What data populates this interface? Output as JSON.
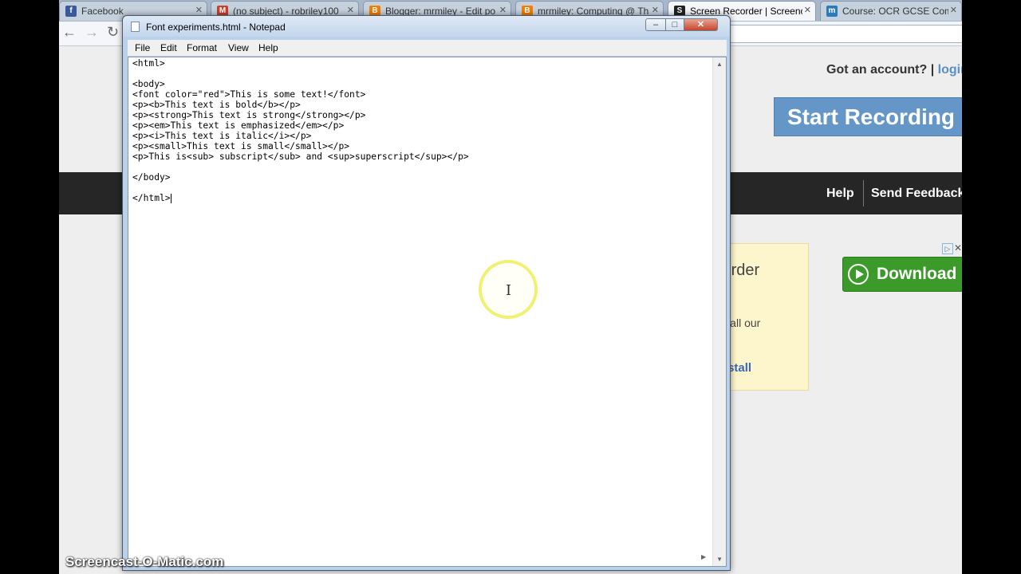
{
  "browser": {
    "tabs": [
      {
        "label": "Facebook",
        "icon": "facebook-icon",
        "icon_color": "#3b5998",
        "glyph": "f"
      },
      {
        "label": "(no subject) - robriley100",
        "icon": "gmail-icon",
        "icon_color": "#c6412d",
        "glyph": "M"
      },
      {
        "label": "Blogger: mrmiley - Edit po",
        "icon": "blogger-icon",
        "icon_color": "#f57d00",
        "glyph": "B"
      },
      {
        "label": "mrmiley: Computing @ Th",
        "icon": "blogger-icon",
        "icon_color": "#f57d00",
        "glyph": "B"
      },
      {
        "label": "Screen Recorder | Screenc",
        "icon": "screencast-o-matic-icon",
        "icon_color": "#222222",
        "glyph": "S",
        "active": true
      },
      {
        "label": "Course: OCR GCSE Compu",
        "icon": "moodle-icon",
        "icon_color": "#2b7bb9",
        "glyph": "m"
      }
    ],
    "page": {
      "account_prompt": "Got an account?",
      "divider": "|",
      "login_link": "login",
      "start_recording_label": "Start Recording",
      "help_link": "Help",
      "feedback_link": "Send Feedback",
      "ad_title": "Screen Recorder\nlooking?",
      "ad_text": "Download and install our",
      "ad_install_link": "Download + Install",
      "download_button_label": "Download"
    }
  },
  "notepad": {
    "title": "Font experiments.html - Notepad",
    "menu": [
      "File",
      "Edit",
      "Format",
      "View",
      "Help"
    ],
    "content": "<html>\n\n<body>\n<font color=\"red\">This is some text!</font>\n<p><b>This text is bold</b></p>\n<p><strong>This text is strong</strong></p>\n<p><em>This text is emphasized</em></p>\n<p><i>This text is italic</i></p>\n<p><small>This text is small</small></p>\n<p>This is<sub> subscript</sub> and <sup>superscript</sup></p>\n\n</body>\n\n</html>"
  },
  "watermark": "Screencast-O-Matic.com",
  "colors": {
    "start_recording": "#6497c7",
    "download_button": "#3b9a2a",
    "dark_bar": "#262626",
    "ad_background": "#fdf6cc"
  }
}
